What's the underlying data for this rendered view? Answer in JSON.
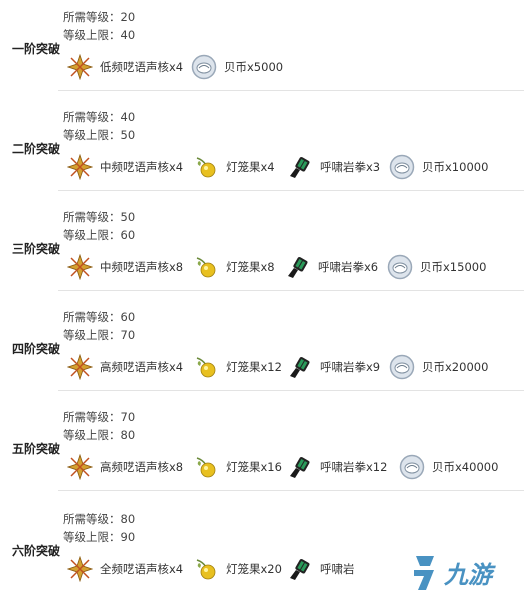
{
  "labels": {
    "required_level": "所需等级：",
    "level_cap": "等级上限："
  },
  "icons": {
    "core": "star-core-icon",
    "fruit": "lantern-fruit-icon",
    "fist": "rock-fist-icon",
    "coin": "shell-coin-icon"
  },
  "colors": {
    "core": "#d4a030",
    "fruit": "#e8c020",
    "fist": "#2a9a5a",
    "coin": "#9aa8b8",
    "watermark": "#2a7fb8"
  },
  "rows": [
    {
      "stage": "一阶突破",
      "required_level": "20",
      "level_cap": "40",
      "materials": [
        {
          "icon": "core",
          "label": "低频呓语声核x4"
        },
        {
          "icon": "coin",
          "label": "贝币x5000"
        }
      ]
    },
    {
      "stage": "二阶突破",
      "required_level": "40",
      "level_cap": "50",
      "materials": [
        {
          "icon": "core",
          "label": "中频呓语声核x4"
        },
        {
          "icon": "fruit",
          "label": "灯笼果x4"
        },
        {
          "icon": "fist",
          "label": "呼啸岩拳x3"
        },
        {
          "icon": "coin",
          "label": "贝币x10000"
        }
      ]
    },
    {
      "stage": "三阶突破",
      "required_level": "50",
      "level_cap": "60",
      "materials": [
        {
          "icon": "core",
          "label": "中频呓语声核x8"
        },
        {
          "icon": "fruit",
          "label": "灯笼果x8"
        },
        {
          "icon": "fist",
          "label": "呼啸岩拳x6"
        },
        {
          "icon": "coin",
          "label": "贝币x15000"
        }
      ]
    },
    {
      "stage": "四阶突破",
      "required_level": "60",
      "level_cap": "70",
      "materials": [
        {
          "icon": "core",
          "label": "高频呓语声核x4"
        },
        {
          "icon": "fruit",
          "label": "灯笼果x12"
        },
        {
          "icon": "fist",
          "label": "呼啸岩拳x9"
        },
        {
          "icon": "coin",
          "label": "贝币x20000"
        }
      ]
    },
    {
      "stage": "五阶突破",
      "required_level": "70",
      "level_cap": "80",
      "materials": [
        {
          "icon": "core",
          "label": "高频呓语声核x8"
        },
        {
          "icon": "fruit",
          "label": "灯笼果x16"
        },
        {
          "icon": "fist",
          "label": "呼啸岩拳x12"
        },
        {
          "icon": "coin",
          "label": "贝币x40000"
        }
      ]
    },
    {
      "stage": "六阶突破",
      "required_level": "80",
      "level_cap": "90",
      "materials": [
        {
          "icon": "core",
          "label": "全频呓语声核x4"
        },
        {
          "icon": "fruit",
          "label": "灯笼果x20"
        },
        {
          "icon": "fist",
          "label": "呼啸岩"
        }
      ]
    }
  ],
  "watermark": {
    "text": "九游"
  }
}
